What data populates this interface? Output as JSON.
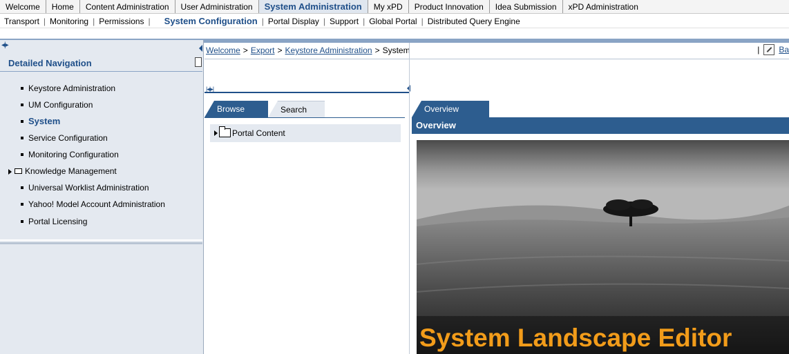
{
  "top_nav": {
    "items": [
      "Welcome",
      "Home",
      "Content Administration",
      "User Administration",
      "System Administration",
      "My xPD",
      "Product Innovation",
      "Idea Submission",
      "xPD Administration"
    ],
    "active": "System Administration"
  },
  "sub_nav": {
    "items": [
      "Transport",
      "Monitoring",
      "Permissions",
      "System Configuration",
      "Portal Display",
      "Support",
      "Global Portal",
      "Distributed Query Engine"
    ],
    "active": "System Configuration"
  },
  "left_panel": {
    "title": "Detailed Navigation",
    "items": [
      {
        "label": "Keystore Administration",
        "kind": "item"
      },
      {
        "label": "UM Configuration",
        "kind": "item"
      },
      {
        "label": "System",
        "kind": "item",
        "active": true
      },
      {
        "label": "Service Configuration",
        "kind": "item"
      },
      {
        "label": "Monitoring Configuration",
        "kind": "item"
      },
      {
        "label": "Knowledge Management",
        "kind": "folder"
      },
      {
        "label": "Universal Worklist Administration",
        "kind": "item"
      },
      {
        "label": "Yahoo! Model Account Administration",
        "kind": "item"
      },
      {
        "label": "Portal Licensing",
        "kind": "item"
      }
    ]
  },
  "breadcrumb": {
    "links": [
      "Welcome",
      "Export",
      "Keystore Administration"
    ],
    "current": "System",
    "separator": ">",
    "back_label": "Ba"
  },
  "browser_panel": {
    "tabs": [
      "Browse",
      "Search"
    ],
    "active_tab": "Browse",
    "tree": [
      {
        "label": "Portal Content",
        "icon": "folder-icon"
      }
    ]
  },
  "overview_panel": {
    "tab": "Overview",
    "header": "Overview",
    "hero_title": "System Landscape Editor"
  },
  "colors": {
    "brand_blue": "#1f4f89",
    "tab_blue": "#2d5d8f",
    "nav_bg": "#e4e9f0",
    "hero_title": "#f29c1a"
  },
  "icons": {
    "pane_toggle": "double-chevron-icon",
    "history": "history-icon",
    "tree_expand": "triangle-right-icon"
  }
}
